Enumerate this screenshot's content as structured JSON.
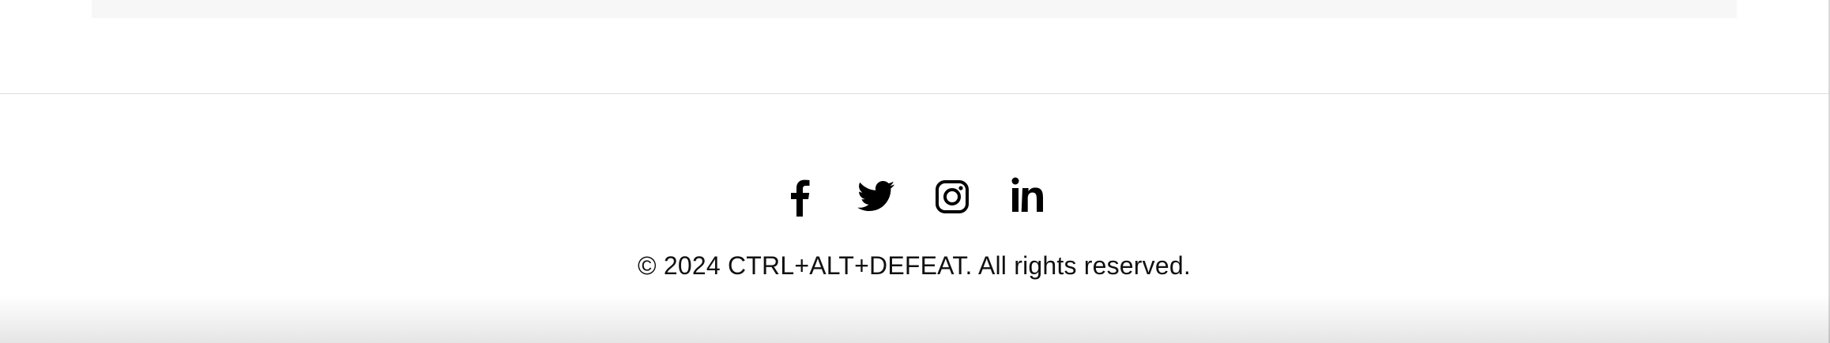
{
  "footer": {
    "social_links": [
      {
        "name": "facebook",
        "icon": "facebook-icon"
      },
      {
        "name": "twitter",
        "icon": "twitter-icon"
      },
      {
        "name": "instagram",
        "icon": "instagram-icon"
      },
      {
        "name": "linkedin",
        "icon": "linkedin-icon"
      }
    ],
    "copyright": "© 2024 CTRL+ALT+DEFEAT. All rights reserved."
  },
  "colors": {
    "icon": "#000000",
    "text": "#111111",
    "divider": "#dedede",
    "strip": "#f7f7f7"
  }
}
